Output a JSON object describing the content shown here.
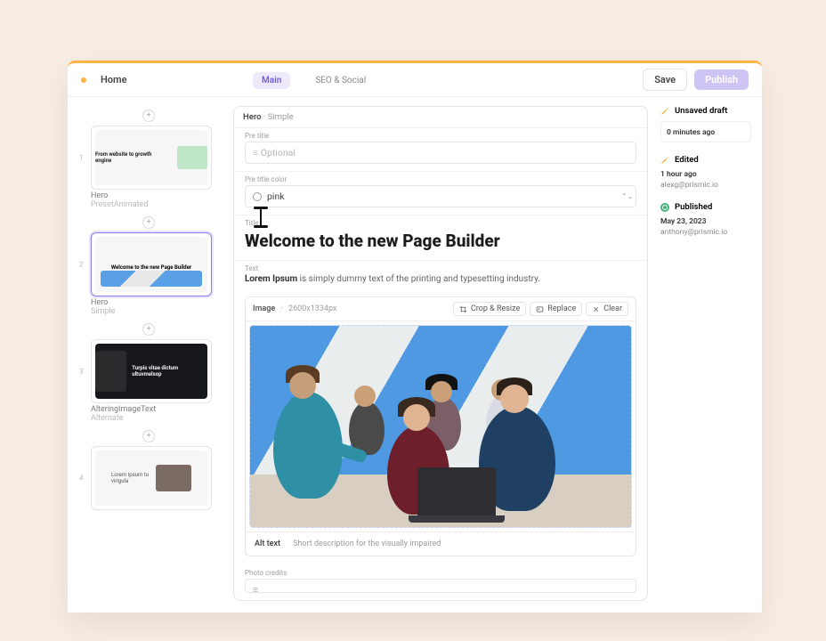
{
  "tabs": {
    "home": "Home",
    "main": "Main",
    "seo": "SEO & Social"
  },
  "actions": {
    "save": "Save",
    "publish": "Publish"
  },
  "slices": [
    {
      "title": "Hero",
      "subtitle": "PresetAnimated",
      "preview_text": "From website to growth engine"
    },
    {
      "title": "Hero",
      "subtitle": "Simple",
      "preview_text": "Welcome to the new Page Builder"
    },
    {
      "title": "AlteringImageText",
      "subtitle": "Alternate",
      "preview_text": "Turpis vitae dictum ultuvmelsop"
    },
    {
      "title": "",
      "subtitle": "",
      "preview_text": "Lorem Ipsum tu virigula"
    }
  ],
  "editor": {
    "slice_name": "Hero",
    "slice_variant": "Simple",
    "pre_title_label": "Pre title",
    "pre_title_placeholder": "Optional",
    "pre_title_color_label": "Pre title color",
    "pre_title_color_value": "pink",
    "title_label": "Title",
    "title_value": "Welcome to the new Page Builder",
    "text_label": "Text",
    "text_value_bold": "Lorem Ipsum",
    "text_value_rest": " is simply dummy text of the printing and typesetting industry.",
    "image_label": "Image",
    "image_dims": "2600x1334px",
    "crop": "Crop & Resize",
    "replace": "Replace",
    "clear": "Clear",
    "alt_label": "Alt text",
    "alt_placeholder": "Short description for the visually impaired",
    "photo_credits_label": "Photo credits"
  },
  "history": {
    "unsaved_label": "Unsaved draft",
    "unsaved_time": "0 minutes ago",
    "edited_label": "Edited",
    "edited_time": "1 hour ago",
    "edited_by": "alexg@prismic.io",
    "published_label": "Published",
    "published_date": "May 23, 2023",
    "published_by": "anthony@prismic.io"
  },
  "colors": {
    "accent": "#8b7bf1",
    "warn": "#ffb347"
  }
}
